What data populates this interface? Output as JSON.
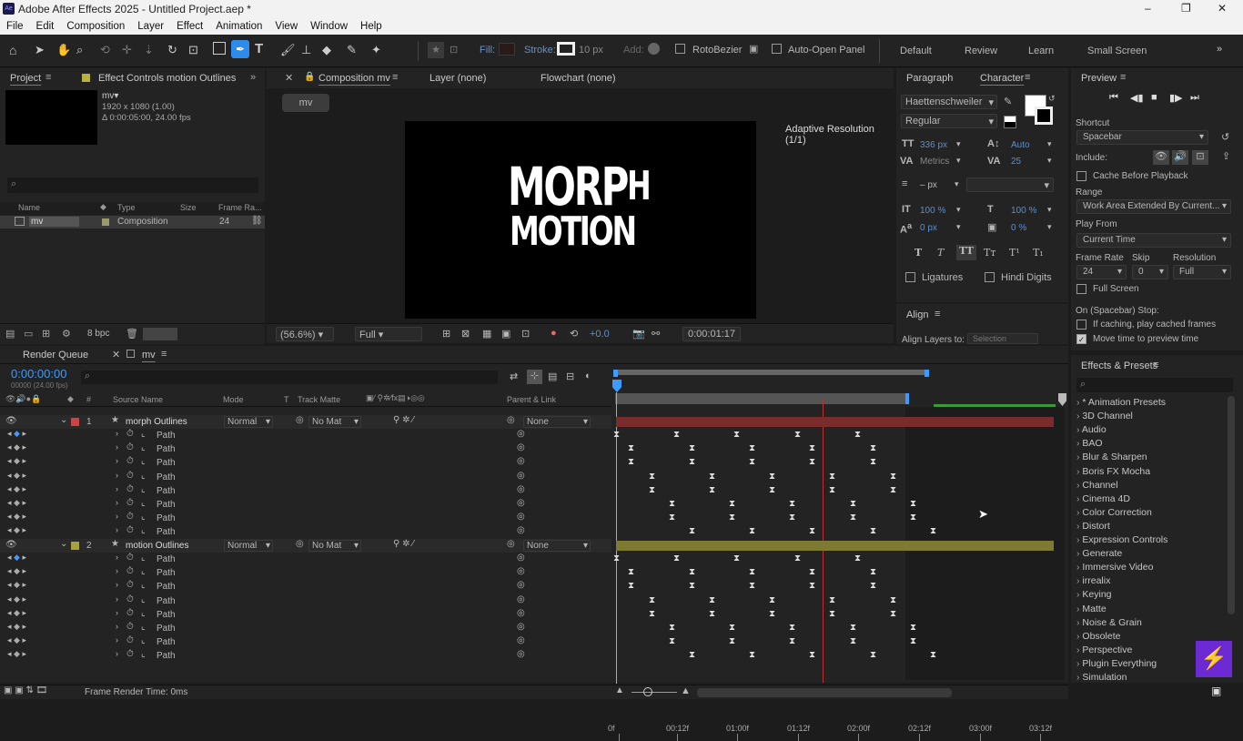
{
  "window": {
    "title": "Adobe After Effects 2025 - Untitled Project.aep *",
    "controls": [
      "–",
      "❐",
      "✕"
    ]
  },
  "menu": [
    "File",
    "Edit",
    "Composition",
    "Layer",
    "Effect",
    "Animation",
    "View",
    "Window",
    "Help"
  ],
  "toolbar": {
    "fill_label": "Fill:",
    "stroke_label": "Stroke:",
    "stroke_px": "10 px",
    "add_label": "Add:",
    "rotobezier": "RotoBezier",
    "auto_open": "Auto-Open Panel",
    "workspaces": [
      "Default",
      "Review",
      "Learn",
      "Small Screen"
    ]
  },
  "project": {
    "tab": "Project",
    "effect_tab": "Effect Controls motion Outlines",
    "comp_name": "mv▾",
    "comp_info": [
      "1920 x 1080 (1.00)",
      "Δ 0:00:05:00, 24.00 fps"
    ],
    "search_placeholder": "",
    "cols": [
      "Name",
      "Type",
      "Size",
      "Frame Ra..."
    ],
    "item": {
      "name": "mv",
      "type": "Composition",
      "fps": "24"
    },
    "bpc": "8 bpc"
  },
  "comp": {
    "tab": "Composition mv",
    "layer_tab": "Layer (none)",
    "flow_tab": "Flowchart (none)",
    "chip": "mv",
    "adaptive": "Adaptive Resolution (1/1)",
    "line1a": "MORP",
    "line1b": "H",
    "line2a": "MO",
    "line2b": "N",
    "line3": "MOTION",
    "zoom": "(56.6%)",
    "quality": "Full",
    "exposure": "+0.0",
    "timecode": "0:00:01:17"
  },
  "character": {
    "tab_para": "Paragraph",
    "tab_char": "Character",
    "font": "Haettenschweiler",
    "style": "Regular",
    "size": "336 px",
    "leading": "Auto",
    "kerning": "Metrics",
    "tracking": "25",
    "stroke_w": "– px",
    "vscale": "100 %",
    "hscale": "100 %",
    "baseline": "0 px",
    "tsume": "0 %",
    "ligatures": "Ligatures",
    "hindi": "Hindi Digits",
    "align_tab": "Align",
    "align_to": "Align Layers to:",
    "align_sel": "Selection"
  },
  "preview": {
    "tab": "Preview",
    "shortcut_label": "Shortcut",
    "shortcut": "Spacebar",
    "include": "Include:",
    "cache": "Cache Before Playback",
    "range_label": "Range",
    "range": "Work Area Extended By Current...",
    "play_from_label": "Play From",
    "play_from": "Current Time",
    "fr_label": "Frame Rate",
    "skip_label": "Skip",
    "res_label": "Resolution",
    "fr": "24",
    "skip": "0",
    "res": "Full",
    "fullscreen": "Full Screen",
    "on_stop": "On (Spacebar) Stop:",
    "if_caching": "If caching, play cached frames",
    "move_time": "Move time to preview time"
  },
  "effects": {
    "tab": "Effects & Presets",
    "items": [
      "* Animation Presets",
      "3D Channel",
      "Audio",
      "BAO",
      "Blur & Sharpen",
      "Boris FX Mocha",
      "Channel",
      "Cinema 4D",
      "Color Correction",
      "Distort",
      "Expression Controls",
      "Generate",
      "Immersive Video",
      "irrealix",
      "Keying",
      "Matte",
      "Noise & Grain",
      "Obsolete",
      "Perspective",
      "Plugin Everything",
      "Simulation"
    ]
  },
  "timeline": {
    "render_tab": "Render Queue",
    "comp_tab": "mv",
    "timecode": "0:00:00:00",
    "subtime": "00000 (24.00 fps)",
    "cols": [
      "#",
      "Source Name",
      "Mode",
      "T",
      "Track Matte",
      "Parent & Link"
    ],
    "ruler": [
      "0f",
      "00:12f",
      "01:00f",
      "01:12f",
      "02:00f",
      "02:12f",
      "03:00f",
      "03:12f"
    ],
    "layers": [
      {
        "num": "1",
        "name": "morph Outlines",
        "mode": "Normal",
        "matte": "No Mat",
        "parent": "None",
        "color": "#c44"
      },
      {
        "num": "2",
        "name": "motion Outlines",
        "mode": "Normal",
        "matte": "No Mat",
        "parent": "None",
        "color": "#a8a040"
      }
    ],
    "path_label": "Path",
    "footer": "Frame Render Time: 0ms"
  },
  "colors": {
    "accent": "#2d8ceb",
    "layer1_bar": "#7a2c2c",
    "layer2_bar": "#7d7a34",
    "cti": "#e03030"
  }
}
